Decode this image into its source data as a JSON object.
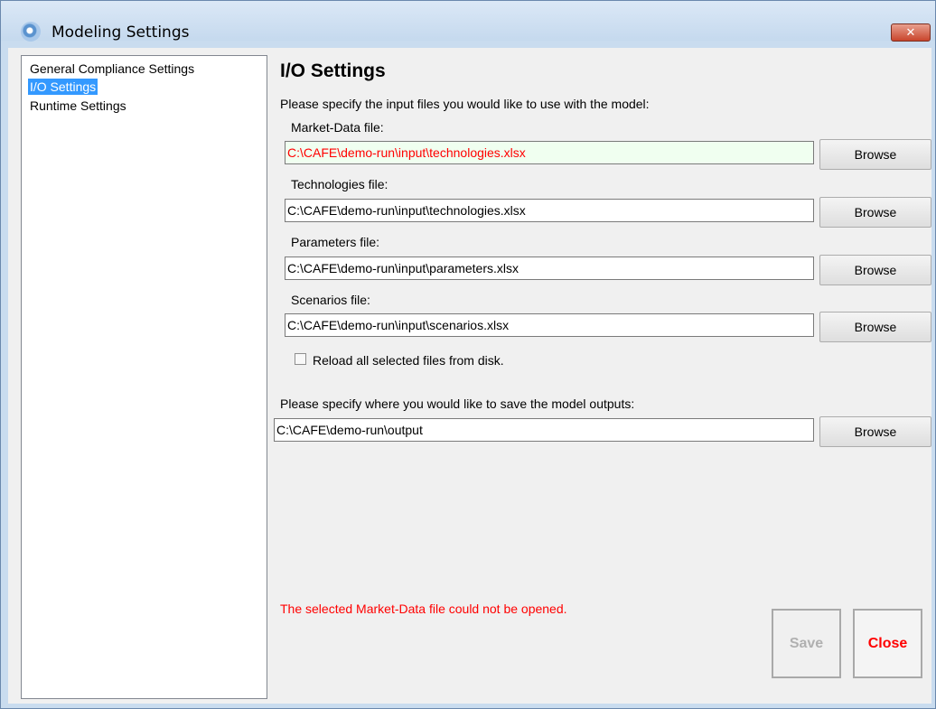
{
  "window": {
    "title": "Modeling Settings",
    "close_glyph": "✕",
    "icon": "settings-gear-icon"
  },
  "nav": {
    "items": [
      {
        "label": "General Compliance Settings",
        "selected": false
      },
      {
        "label": "I/O Settings",
        "selected": true
      },
      {
        "label": "Runtime Settings",
        "selected": false
      }
    ]
  },
  "main": {
    "heading": "I/O Settings",
    "input_prompt": "Please specify the input files you would like to use with the model:",
    "files": [
      {
        "label": "Market-Data file:",
        "value": "C:\\CAFE\\demo-run\\input\\technologies.xlsx",
        "browse": "Browse",
        "error": true
      },
      {
        "label": "Technologies file:",
        "value": "C:\\CAFE\\demo-run\\input\\technologies.xlsx",
        "browse": "Browse",
        "error": false
      },
      {
        "label": "Parameters file:",
        "value": "C:\\CAFE\\demo-run\\input\\parameters.xlsx",
        "browse": "Browse",
        "error": false
      },
      {
        "label": "Scenarios file:",
        "value": "C:\\CAFE\\demo-run\\input\\scenarios.xlsx",
        "browse": "Browse",
        "error": false
      }
    ],
    "reload_label": "Reload all selected files from disk.",
    "reload_checked": false,
    "output_prompt": "Please specify where you would like to save the model outputs:",
    "output": {
      "value": "C:\\CAFE\\demo-run\\output",
      "browse": "Browse"
    },
    "error_message": "The selected Market-Data file could not be opened.",
    "save_label": "Save",
    "close_label": "Close"
  },
  "colors": {
    "error": "#ff0000",
    "selection": "#3399ff",
    "error_field_bg": "#f0fff0"
  }
}
